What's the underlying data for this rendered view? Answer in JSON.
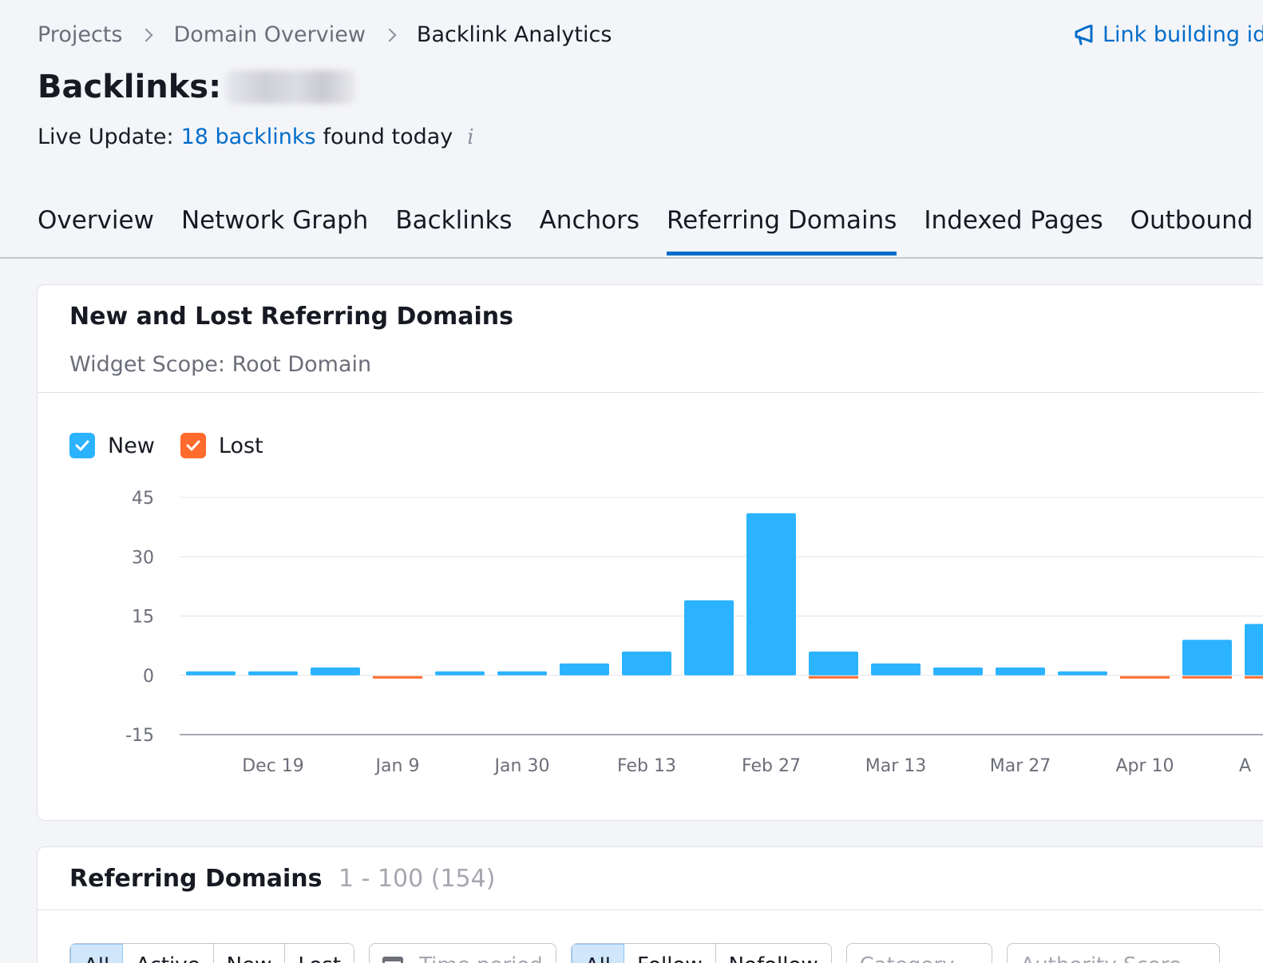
{
  "breadcrumb": {
    "items": [
      "Projects",
      "Domain Overview",
      "Backlink Analytics"
    ]
  },
  "promo": {
    "label": "Link building id"
  },
  "header": {
    "title": "Backlinks:"
  },
  "live": {
    "prefix": "Live Update:",
    "link": "18 backlinks",
    "suffix": "found today",
    "info": "i"
  },
  "tabs": [
    "Overview",
    "Network Graph",
    "Backlinks",
    "Anchors",
    "Referring Domains",
    "Indexed Pages",
    "Outbound Do"
  ],
  "active_tab": "Referring Domains",
  "widget": {
    "title": "New and Lost Referring Domains",
    "scope": "Widget Scope: Root Domain",
    "legend": {
      "new": "New",
      "lost": "Lost"
    }
  },
  "colors": {
    "accent": "#006dca",
    "new": "#2bb3ff",
    "lost": "#ff6b2d"
  },
  "chart_data": {
    "type": "bar",
    "yticks": [
      45,
      30,
      15,
      0,
      -15
    ],
    "ylim": [
      -15,
      45
    ],
    "xtick_labels": [
      "Dec 19",
      "Jan 9",
      "Jan 30",
      "Feb 13",
      "Feb 27",
      "Mar 13",
      "Mar 27",
      "Apr 10",
      "A"
    ],
    "series": [
      {
        "name": "New",
        "values": [
          1,
          1,
          2,
          0,
          1,
          1,
          3,
          6,
          19,
          41,
          6,
          3,
          2,
          2,
          1,
          0,
          9,
          13
        ]
      },
      {
        "name": "Lost",
        "values": [
          0,
          0,
          0,
          -1,
          0,
          0,
          0,
          0,
          0,
          0,
          -1,
          0,
          0,
          0,
          0,
          -1,
          -1,
          -1
        ]
      }
    ]
  },
  "table": {
    "title": "Referring Domains",
    "range": "1 - 100 (154)",
    "status_filter": [
      "All",
      "Active",
      "New",
      "Lost"
    ],
    "time_period_placeholder": "Time period",
    "follow_filter": [
      "All",
      "Follow",
      "Nofollow"
    ],
    "category_placeholder": "Category",
    "authority_placeholder": "Authority Score"
  }
}
